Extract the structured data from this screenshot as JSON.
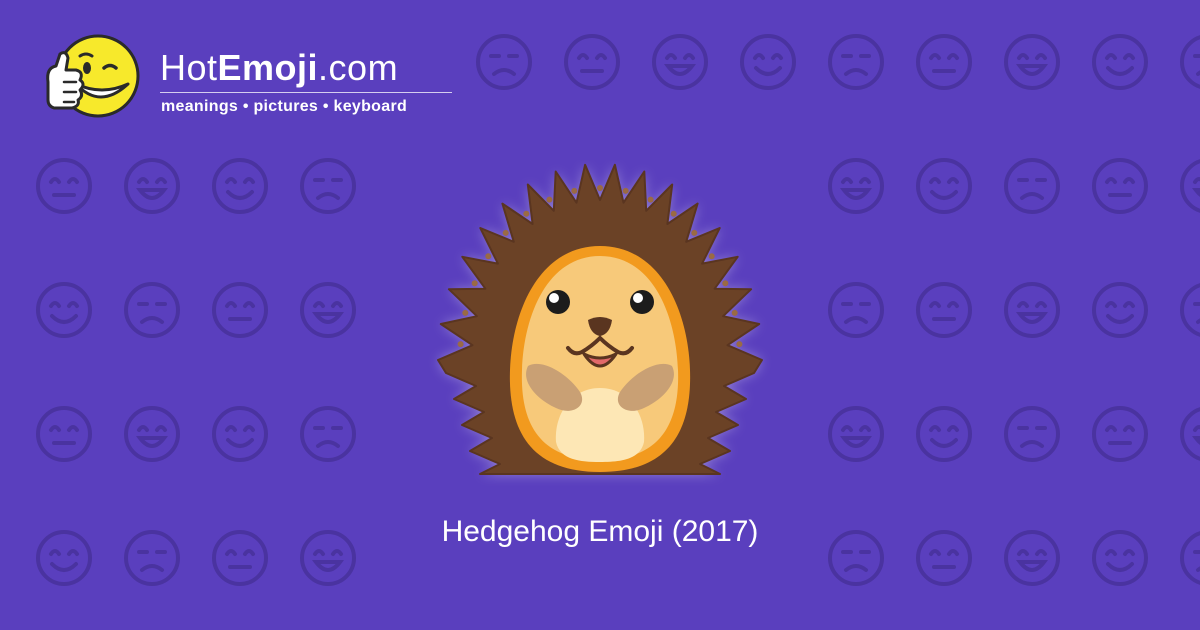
{
  "header": {
    "site_name_prefix": "Hot",
    "site_name_bold": "Emoji",
    "site_name_suffix": ".com",
    "tagline": "meanings • pictures • keyboard"
  },
  "hero": {
    "emoji_icon": "hedgehog-icon",
    "caption": "Hedgehog Emoji (2017)"
  },
  "colors": {
    "background": "#5a3fbe",
    "pattern": "#4a33a0",
    "text": "#ffffff",
    "mascot_yellow": "#f7e92b",
    "hedgehog_spikes": "#6b4226",
    "hedgehog_outline": "#f29a1e",
    "hedgehog_face": "#f7c97a",
    "hedgehog_belly": "#fde7b5"
  }
}
